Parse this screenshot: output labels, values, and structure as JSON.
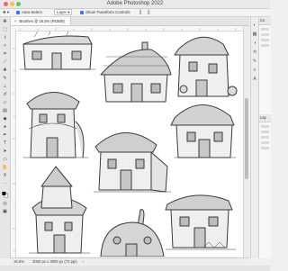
{
  "window": {
    "title": "Adobe Photoshop 2022"
  },
  "options_bar": {
    "auto_select_label": "Auto-Select",
    "layer_select_value": "Layer",
    "show_transform_label": "Show Transform Controls"
  },
  "document": {
    "tab_title": "Brushes @ 16.5% (RGB/8)",
    "tab_close_glyph": "×",
    "zoom": "16.5%",
    "dimensions": "3000 px x 3000 px (72 ppi)",
    "status_arrow": "›"
  },
  "right_panel": {
    "top_label": "Co",
    "middle_label": "Lay"
  },
  "icons": {
    "toolbox": [
      "move-tool-icon",
      "marquee-tool-icon",
      "lasso-tool-icon",
      "magic-wand-icon",
      "crop-tool-icon",
      "eyedropper-icon",
      "healing-brush-icon",
      "brush-tool-icon",
      "clone-stamp-icon",
      "history-brush-icon",
      "eraser-icon",
      "gradient-tool-icon",
      "blur-tool-icon",
      "dodge-tool-icon",
      "pen-tool-icon",
      "type-tool-icon",
      "path-select-icon",
      "shape-tool-icon",
      "hand-tool-icon",
      "zoom-tool-icon",
      "more-tools-icon",
      "foreground-color-icon",
      "quick-mask-icon",
      "screen-mode-icon"
    ]
  },
  "colors": {
    "accent": "#3478f6"
  }
}
